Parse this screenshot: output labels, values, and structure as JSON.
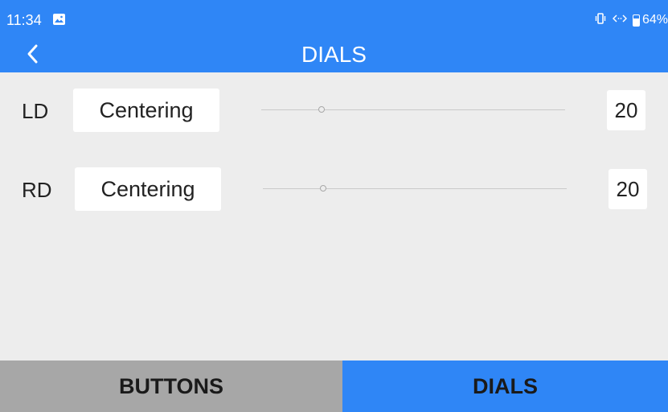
{
  "status_bar": {
    "time": "11:34",
    "battery_text": "64%",
    "battery_level": 0.64,
    "icons": [
      "image-notification-icon",
      "vibrate-icon",
      "data-transfer-icon",
      "battery-icon"
    ]
  },
  "header": {
    "title": "DIALS",
    "back_icon": "chevron-left-icon"
  },
  "dials": [
    {
      "label": "LD",
      "mode": "Centering",
      "value": "20",
      "slider_fraction": 0.2
    },
    {
      "label": "RD",
      "mode": "Centering",
      "value": "20",
      "slider_fraction": 0.2
    }
  ],
  "tabs": [
    {
      "label": "BUTTONS",
      "active": false
    },
    {
      "label": "DIALS",
      "active": true
    }
  ],
  "colors": {
    "accent": "#2f86f6",
    "background": "#ededed",
    "inactive_tab": "#a7a7a7"
  }
}
